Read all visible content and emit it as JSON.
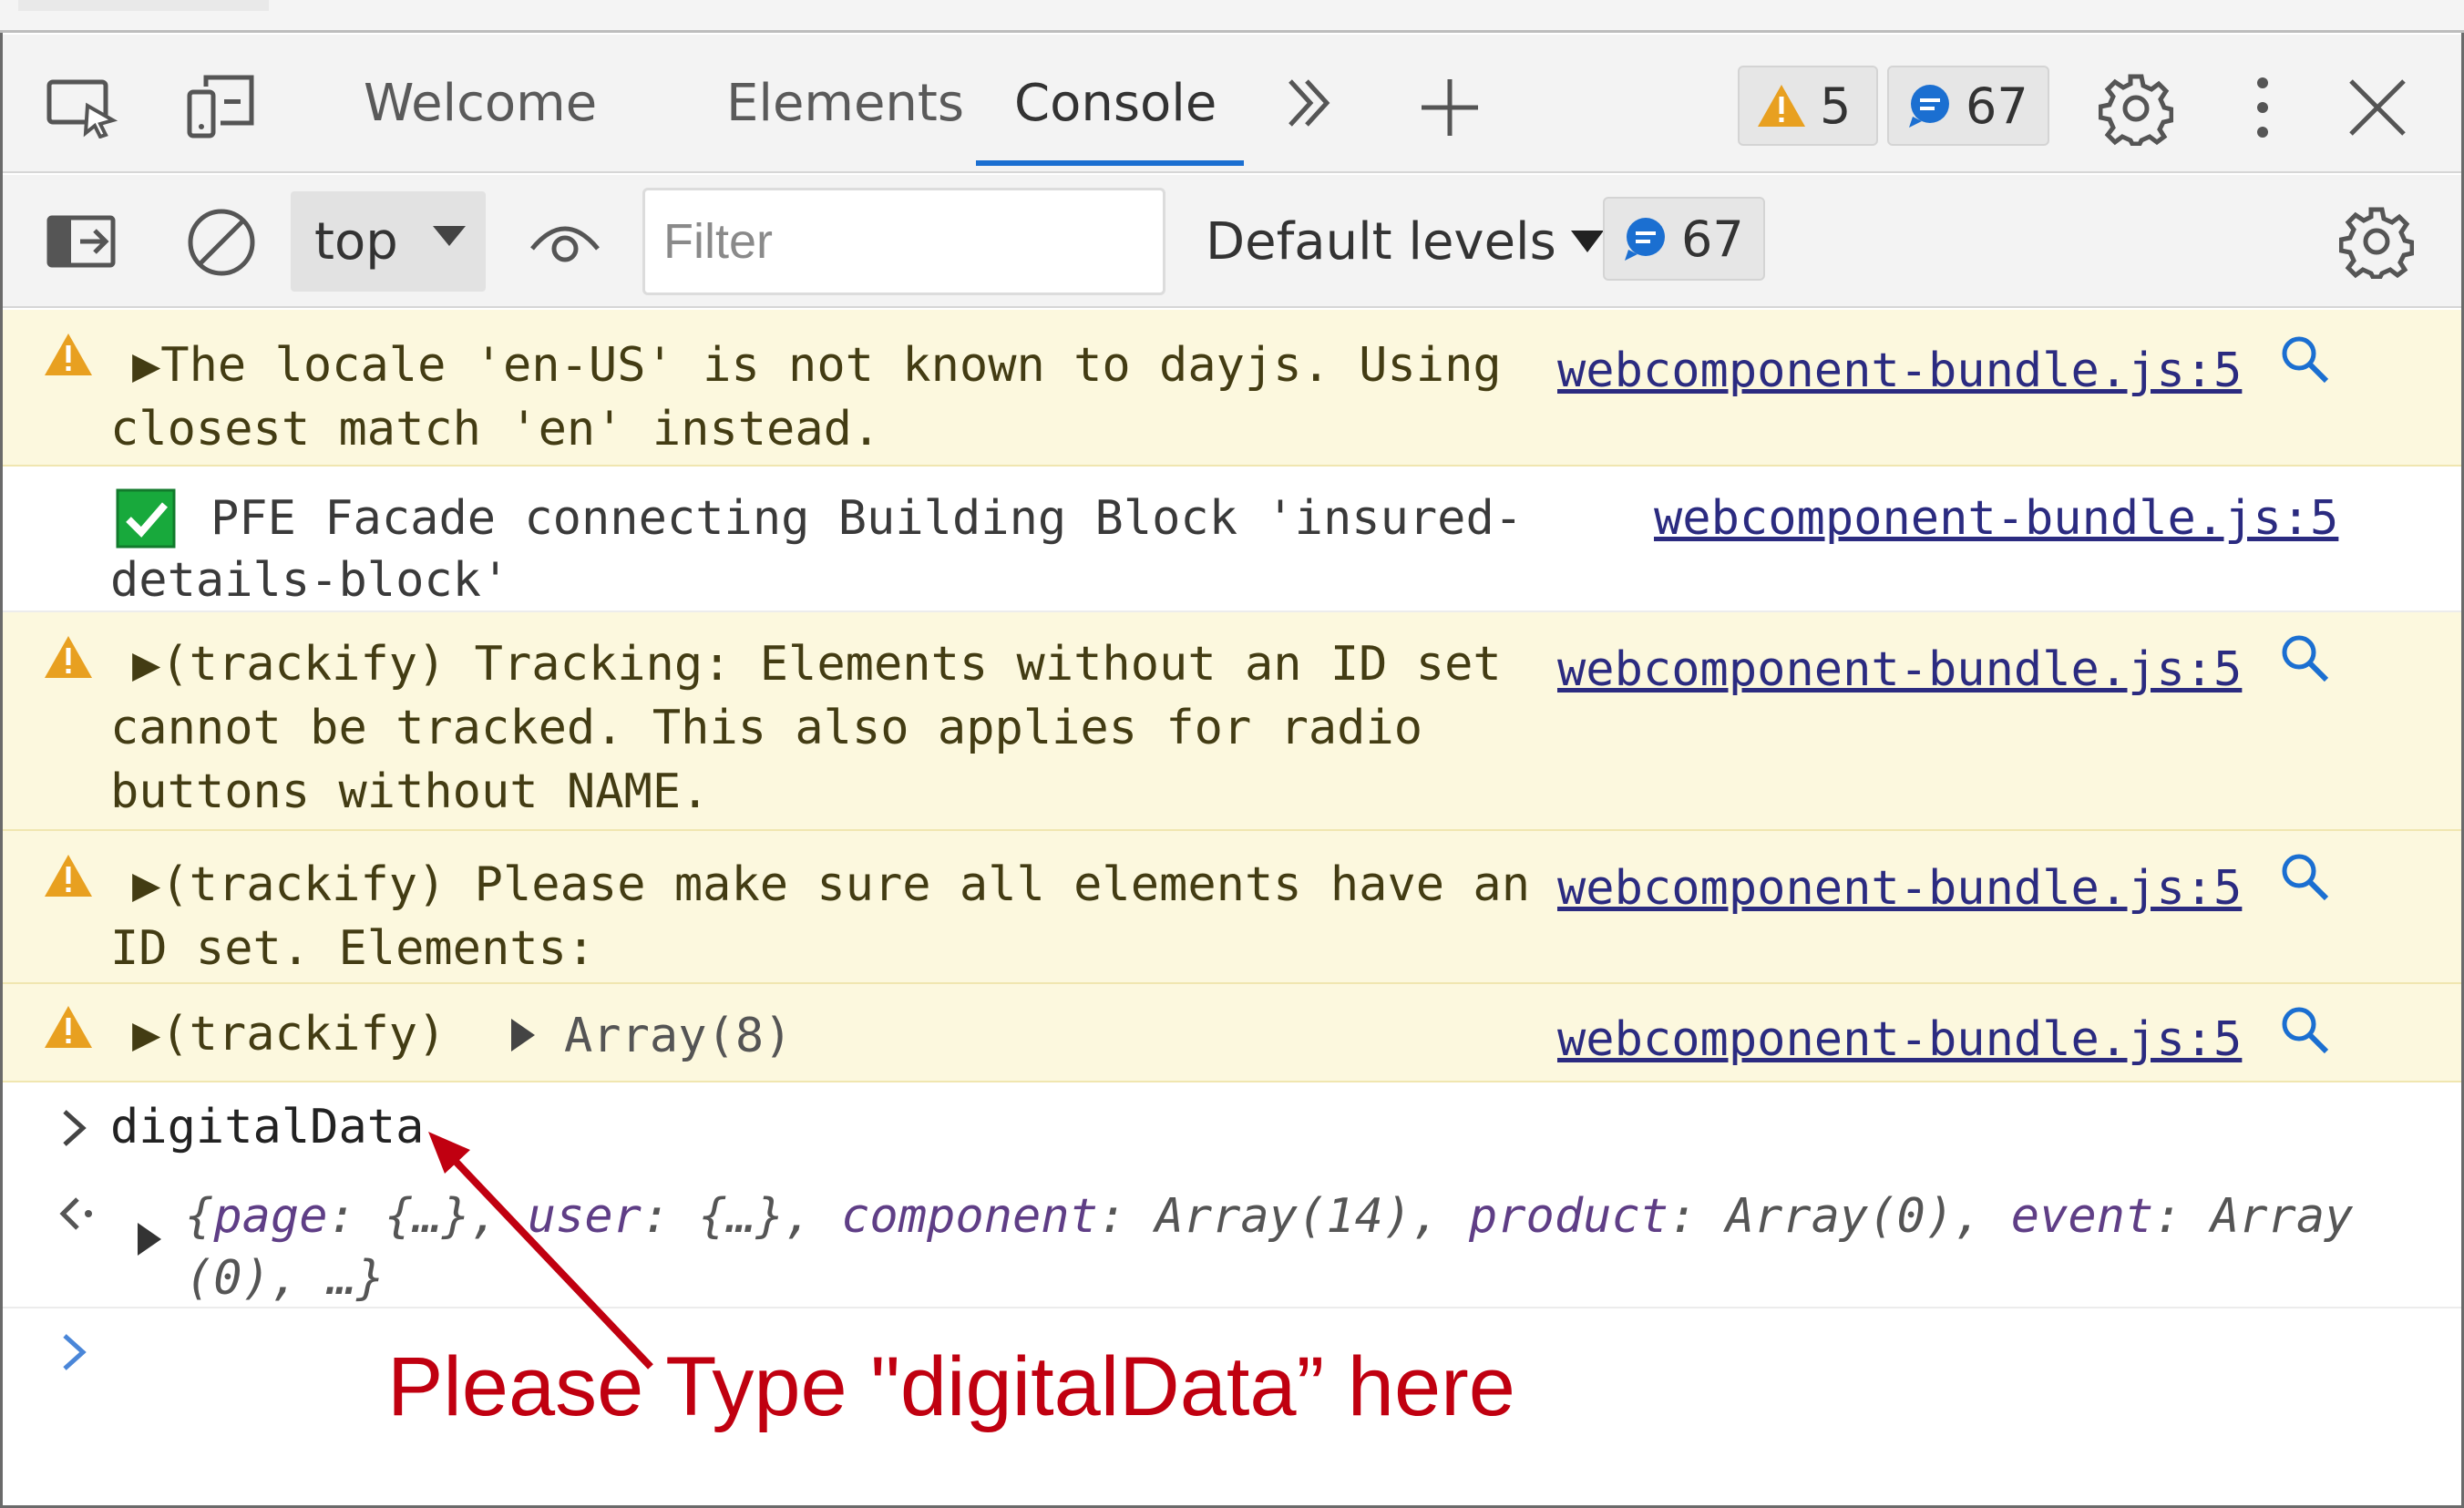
{
  "devtools": {
    "tabs": [
      {
        "label": "Welcome"
      },
      {
        "label": "Elements"
      },
      {
        "label": "Console",
        "active": true
      }
    ],
    "warnings_count": "5",
    "messages_count": "67"
  },
  "console_toolbar": {
    "context": "top",
    "filter_placeholder": "Filter",
    "levels_label": "Default levels",
    "messages_count": "67"
  },
  "messages": [
    {
      "level": "warning",
      "lines": [
        "▶The locale 'en-US' is not known to dayjs. Using",
        "closest match 'en' instead."
      ],
      "source": "webcomponent-bundle.js:5"
    },
    {
      "level": "log",
      "icon": "check-mark-icon",
      "lines": [
        "PFE Facade connecting Building Block 'insured-",
        "details-block'"
      ],
      "source": "webcomponent-bundle.js:5"
    },
    {
      "level": "warning",
      "lines": [
        "▶(trackify) Tracking: Elements without an ID set",
        "cannot be tracked. This also applies for radio",
        "buttons without NAME."
      ],
      "source": "webcomponent-bundle.js:5"
    },
    {
      "level": "warning",
      "lines": [
        "▶(trackify) Please make sure all elements have an",
        "ID set. Elements:"
      ],
      "source": "webcomponent-bundle.js:5"
    },
    {
      "level": "warning",
      "prefix": "▶(trackify)",
      "array_label": "Array(8)",
      "source": "webcomponent-bundle.js:5"
    }
  ],
  "input_command": "digitalData",
  "result": {
    "page_key": "page",
    "page_val": "{…}",
    "user_key": "user",
    "user_val": "{…}",
    "component_key": "component",
    "component_val": "Array(14)",
    "product_key": "product",
    "product_val": "Array(0)",
    "event_key": "event",
    "event_val": "Array",
    "line2": "(0), …}"
  },
  "annotation": {
    "text": "Please Type \"digitalData” here",
    "color": "#c00010"
  },
  "colors": {
    "accent": "#1b6fd1",
    "warning": "#e8a020",
    "warning_bg": "#fcf8de",
    "link": "#2b2b80"
  }
}
